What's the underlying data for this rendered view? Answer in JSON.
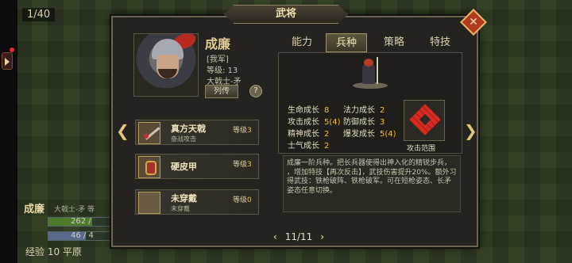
{
  "top_counter": "1/40",
  "background_unit": {
    "name": "成廉",
    "subtitle": "大戟士-矛 等",
    "hp": "262 / ",
    "mp": "46 / 4",
    "exp_label": "经验 10 平原"
  },
  "dialog": {
    "title": "武将",
    "close_icon": "close-x-icon"
  },
  "general": {
    "name": "成廉",
    "faction": "[我军]",
    "level": "等级: 13",
    "unit_type": "大戟士-矛",
    "bio_button": "列传",
    "help_button": "?"
  },
  "equipment": [
    {
      "name": "真方天戟",
      "level_label": "等级",
      "level": "3",
      "desc": "奋战攻击",
      "icon": "halberd-icon"
    },
    {
      "name": "硬皮甲",
      "level_label": "等级",
      "level": "3",
      "desc": "",
      "icon": "armor-icon"
    },
    {
      "name": "未穿戴",
      "level_label": "等级",
      "level": "0",
      "desc": "未穿戴",
      "icon": "empty-slot-icon"
    }
  ],
  "tabs": [
    {
      "label": "能力",
      "active": false
    },
    {
      "label": "兵种",
      "active": true
    },
    {
      "label": "策略",
      "active": false
    },
    {
      "label": "特技",
      "active": false
    }
  ],
  "growth_stats": [
    {
      "label": "生命成长",
      "value": "8"
    },
    {
      "label": "攻击成长",
      "value": "5(4)"
    },
    {
      "label": "精神成长",
      "value": "2"
    },
    {
      "label": "士气成长",
      "value": "2"
    },
    {
      "label": "法力成长",
      "value": "2"
    },
    {
      "label": "防御成长",
      "value": "3"
    },
    {
      "label": "爆发成长",
      "value": "5(4)"
    }
  ],
  "attack_range_label": "攻击范围",
  "description": "成廉一阶兵种。把长兵器使得出神入化的精锐步兵， ，增加特技【再次反击】，武技伤害提升20%。额外习得武技：铁枪破阵、铁枪破军。可在短枪姿态、长矛姿态任意切换。",
  "pager": {
    "current": "11/11",
    "prev": "‹",
    "next": "›"
  },
  "colors": {
    "accent_gold": "#f0c02e",
    "range_red": "#d82a1e",
    "close_red": "#b03a1e"
  }
}
